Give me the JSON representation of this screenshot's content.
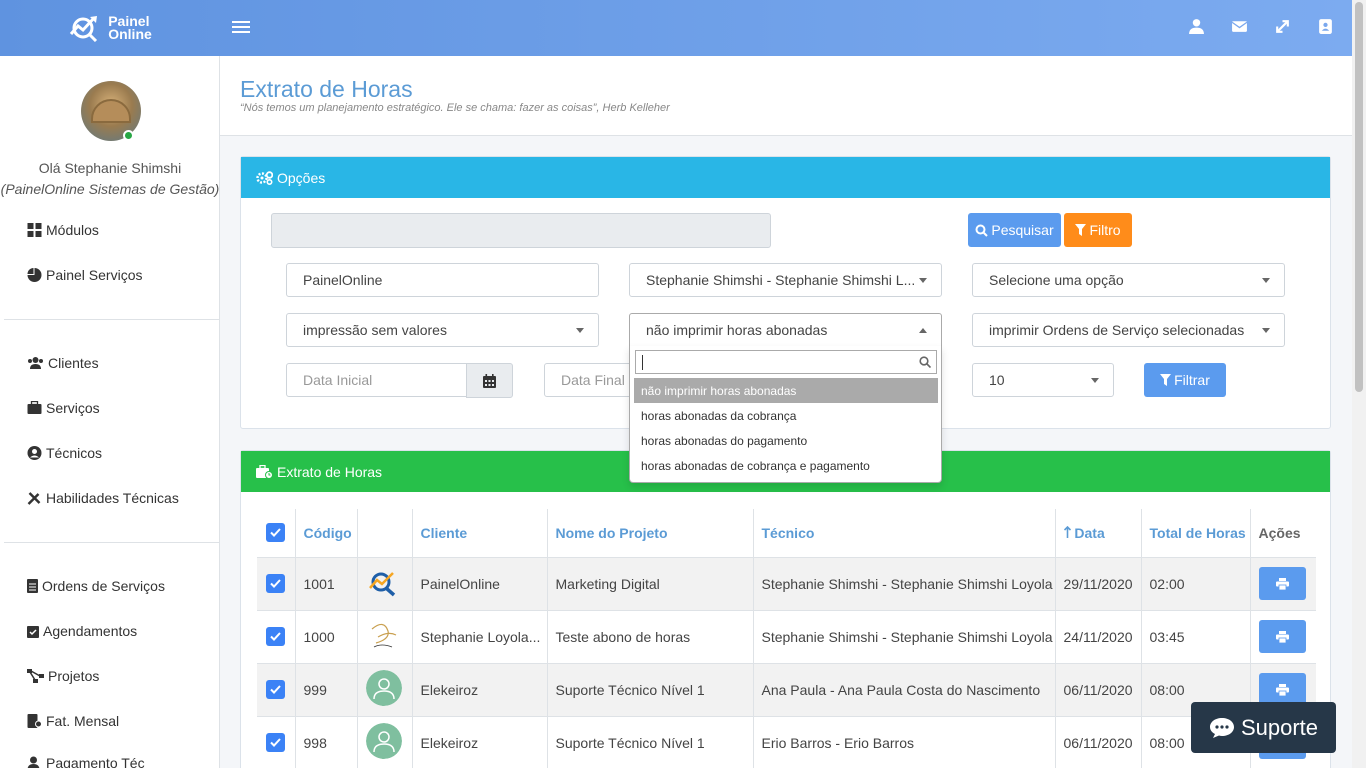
{
  "brand": {
    "line1": "Painel",
    "line2": "Online"
  },
  "sidebar": {
    "greeting": "Olá Stephanie Shimshi",
    "company": "(PainelOnline Sistemas de Gestão)",
    "items": [
      {
        "label": "Módulos",
        "icon": "grid-icon"
      },
      {
        "label": "Painel Serviços",
        "icon": "pie-chart-icon"
      },
      {
        "label": "Clientes",
        "icon": "users-icon"
      },
      {
        "label": "Serviços",
        "icon": "briefcase-icon"
      },
      {
        "label": "Técnicos",
        "icon": "user-circle-icon"
      },
      {
        "label": "Habilidades Técnicas",
        "icon": "tools-icon"
      },
      {
        "label": "Ordens de Serviços",
        "icon": "file-list-icon"
      },
      {
        "label": "Agendamentos",
        "icon": "calendar-check-icon"
      },
      {
        "label": "Projetos",
        "icon": "project-diagram-icon"
      },
      {
        "label": "Fat. Mensal",
        "icon": "invoice-icon"
      },
      {
        "label": "Pagamento Téc",
        "icon": "user-payment-icon"
      }
    ]
  },
  "header": {
    "title": "Extrato de Horas",
    "subtitle": "“Nós temos um planejamento estratégico. Ele se chama: fazer as coisas”, Herb Kelleher"
  },
  "opcoes": {
    "title": "Opções",
    "pesquisar": "Pesquisar",
    "filtro": "Filtro",
    "cliente": "PainelOnline",
    "tecnico": "Stephanie Shimshi - Stephanie Shimshi L...",
    "opcao": "Selecione uma opção",
    "impressao": "impressão sem valores",
    "abono": "não imprimir horas abonadas",
    "ordens": "imprimir Ordens de Serviço selecionadas",
    "data_inicial_ph": "Data Inicial",
    "data_final_ph": "Data Final",
    "qtd": "10",
    "filtrar": "Filtrar"
  },
  "dropdown": {
    "options": [
      "não imprimir horas abonadas",
      "horas abonadas da cobrança",
      "horas abonadas do pagamento",
      "horas abonadas de cobrança e pagamento"
    ],
    "selected_index": 0
  },
  "extrato": {
    "title": "Extrato de Horas",
    "columns": [
      "Código",
      "Cliente",
      "Nome do Projeto",
      "Técnico",
      "Data",
      "Total de Horas",
      "Ações"
    ],
    "rows": [
      {
        "codigo": "1001",
        "cliente": "PainelOnline",
        "projeto": "Marketing Digital",
        "tecnico": "Stephanie Shimshi - Stephanie Shimshi Loyola",
        "data": "29/11/2020",
        "horas": "02:00"
      },
      {
        "codigo": "1000",
        "cliente": "Stephanie Loyola...",
        "projeto": "Teste abono de horas",
        "tecnico": "Stephanie Shimshi - Stephanie Shimshi Loyola",
        "data": "24/11/2020",
        "horas": "03:45"
      },
      {
        "codigo": "999",
        "cliente": "Elekeiroz",
        "projeto": "Suporte Técnico Nível 1",
        "tecnico": "Ana Paula - Ana Paula Costa do Nascimento",
        "data": "06/11/2020",
        "horas": "08:00"
      },
      {
        "codigo": "998",
        "cliente": "Elekeiroz",
        "projeto": "Suporte Técnico Nível 1",
        "tecnico": "Erio Barros - Erio Barros",
        "data": "06/11/2020",
        "horas": "08:00"
      }
    ]
  },
  "support": {
    "label": "Suporte"
  },
  "colors": {
    "accent": "#5b9bee",
    "opcoes_header": "#29b6e6",
    "extrato_header": "#27c04a",
    "filtro": "#ff8c1a"
  }
}
